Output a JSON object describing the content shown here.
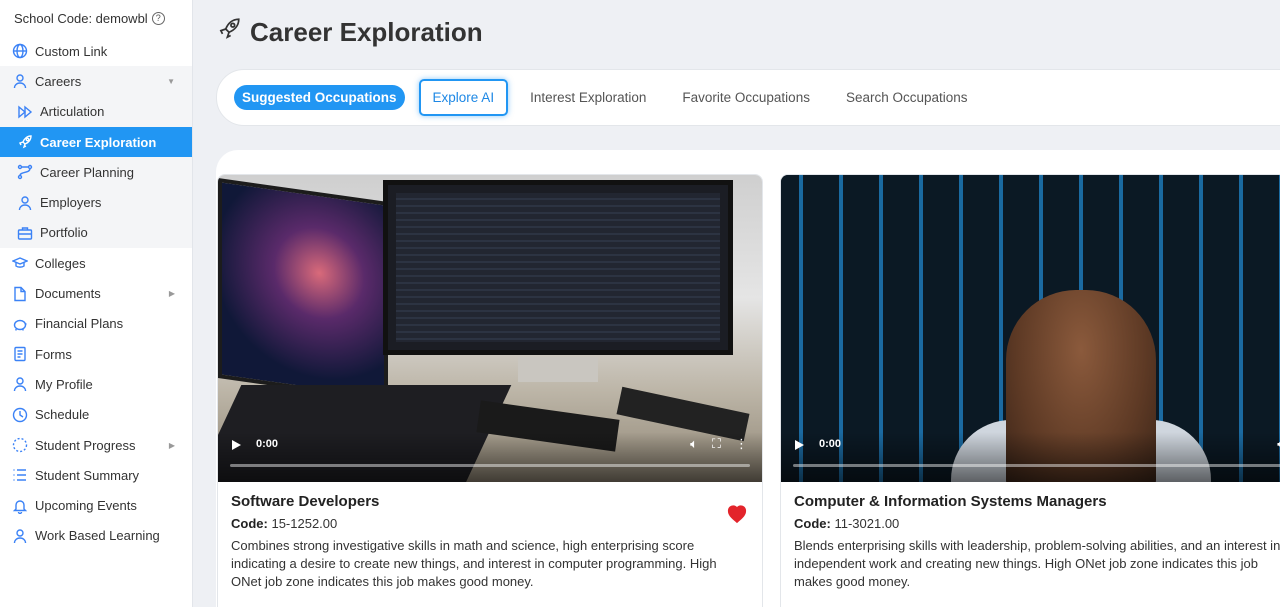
{
  "school": {
    "label": "School Code: demowbl",
    "help_icon": "?"
  },
  "sidebar": {
    "items": [
      {
        "label": "Custom Link",
        "icon": "globe-icon"
      },
      {
        "label": "Careers",
        "icon": "user-icon"
      },
      {
        "label": "Articulation",
        "icon": "forward-icon"
      },
      {
        "label": "Career Exploration",
        "icon": "rocket-icon"
      },
      {
        "label": "Career Planning",
        "icon": "route-icon"
      },
      {
        "label": "Employers",
        "icon": "user-icon"
      },
      {
        "label": "Portfolio",
        "icon": "briefcase-icon"
      },
      {
        "label": "Colleges",
        "icon": "graduation-cap-icon"
      },
      {
        "label": "Documents",
        "icon": "document-icon"
      },
      {
        "label": "Financial Plans",
        "icon": "piggy-bank-icon"
      },
      {
        "label": "Forms",
        "icon": "form-icon"
      },
      {
        "label": "My Profile",
        "icon": "user-icon"
      },
      {
        "label": "Schedule",
        "icon": "clock-icon"
      },
      {
        "label": "Student Progress",
        "icon": "progress-icon"
      },
      {
        "label": "Student Summary",
        "icon": "list-icon"
      },
      {
        "label": "Upcoming Events",
        "icon": "bell-icon"
      },
      {
        "label": "Work Based Learning",
        "icon": "user-icon"
      }
    ],
    "accent": "#2196f3"
  },
  "header": {
    "title": "Career Exploration"
  },
  "tabs": [
    {
      "label": "Suggested Occupations"
    },
    {
      "label": "Explore AI"
    },
    {
      "label": "Interest Exploration"
    },
    {
      "label": "Favorite Occupations"
    },
    {
      "label": "Search Occupations"
    }
  ],
  "cards": [
    {
      "title": "Software Developers",
      "code_label": "Code:",
      "code": "15-1252.00",
      "time": "0:00",
      "favorite": true,
      "description": "Combines strong investigative skills in math and science, high enterprising score indicating a desire to create new things, and interest in computer programming. High ONet job zone indicates this job makes good money."
    },
    {
      "title": "Computer & Information Systems Managers",
      "code_label": "Code:",
      "code": "11-3021.00",
      "time": "0:00",
      "favorite": false,
      "description": "Blends enterprising skills with leadership, problem-solving abilities, and an interest in independent work and creating new things. High ONet job zone indicates this job makes good money."
    }
  ]
}
